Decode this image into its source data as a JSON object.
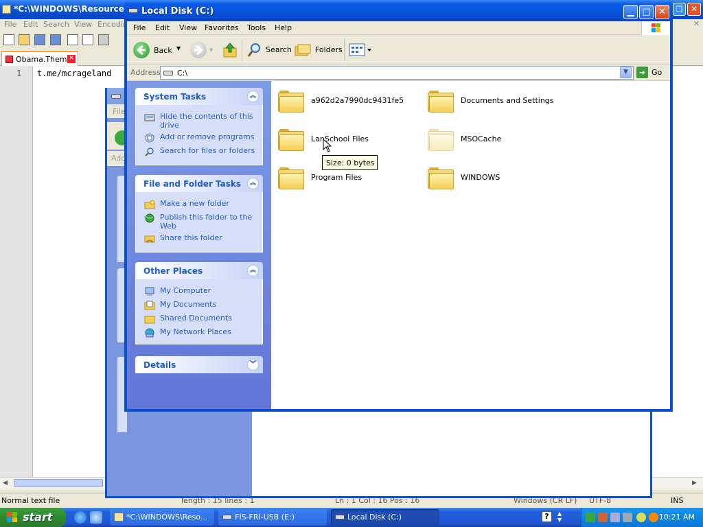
{
  "notepad": {
    "title": "*C:\\WINDOWS\\Resources\\",
    "menu": [
      "File",
      "Edit",
      "Search",
      "View",
      "Encoding"
    ],
    "tab_label": "Obama.Theme",
    "line_number": "1",
    "line_text": "t.me/mcrageland",
    "status_left": "Normal text file",
    "status_length": "length : 15    lines : 1",
    "status_pos": "Ln : 1    Col : 16    Pos : 16",
    "status_eol": "Windows (CR LF)",
    "status_enc": "UTF-8",
    "status_ins": "INS"
  },
  "middle_window": {
    "menu_fragment": "File",
    "address_fragment": "Add"
  },
  "explorer": {
    "title": "Local Disk (C:)",
    "menu": [
      "File",
      "Edit",
      "View",
      "Favorites",
      "Tools",
      "Help"
    ],
    "toolbar": {
      "back": "Back",
      "search": "Search",
      "folders": "Folders"
    },
    "address": {
      "label": "Address",
      "value": "C:\\",
      "go": "Go"
    },
    "panels": {
      "system_tasks": {
        "title": "System Tasks",
        "items": [
          {
            "label": "Hide the contents of this drive",
            "icon": "hide-drive-icon"
          },
          {
            "label": "Add or remove programs",
            "icon": "add-remove-programs-icon"
          },
          {
            "label": "Search for files or folders",
            "icon": "search-icon"
          }
        ]
      },
      "file_folder_tasks": {
        "title": "File and Folder Tasks",
        "items": [
          {
            "label": "Make a new folder",
            "icon": "new-folder-icon"
          },
          {
            "label": "Publish this folder to the Web",
            "icon": "globe-icon"
          },
          {
            "label": "Share this folder",
            "icon": "share-folder-icon"
          }
        ]
      },
      "other_places": {
        "title": "Other Places",
        "items": [
          {
            "label": "My Computer",
            "icon": "my-computer-icon"
          },
          {
            "label": "My Documents",
            "icon": "my-documents-icon"
          },
          {
            "label": "Shared Documents",
            "icon": "shared-documents-icon"
          },
          {
            "label": "My Network Places",
            "icon": "network-places-icon"
          }
        ]
      },
      "details": {
        "title": "Details"
      }
    },
    "files": [
      {
        "name": "a962d2a7990dc9431fe5",
        "hidden": false
      },
      {
        "name": "Documents and Settings",
        "hidden": false
      },
      {
        "name": "LanSchool Files",
        "hidden": false
      },
      {
        "name": "MSOCache",
        "hidden": true
      },
      {
        "name": "Program Files",
        "hidden": false
      },
      {
        "name": "WINDOWS",
        "hidden": false
      }
    ],
    "tooltip": "Size: 0 bytes"
  },
  "taskbar": {
    "start": "start",
    "buttons": [
      {
        "label": "*C:\\WINDOWS\\Reso...",
        "active": false
      },
      {
        "label": "FIS-FRI-USB (E:)",
        "active": false
      },
      {
        "label": "Local Disk (C:)",
        "active": true
      }
    ],
    "clock": "10:21 AM"
  },
  "colors": {
    "xp_blue": "#0a50d0",
    "task_link": "#215dc6",
    "start_green": "#3b9b3b",
    "tray_blue": "#0f85e4"
  }
}
